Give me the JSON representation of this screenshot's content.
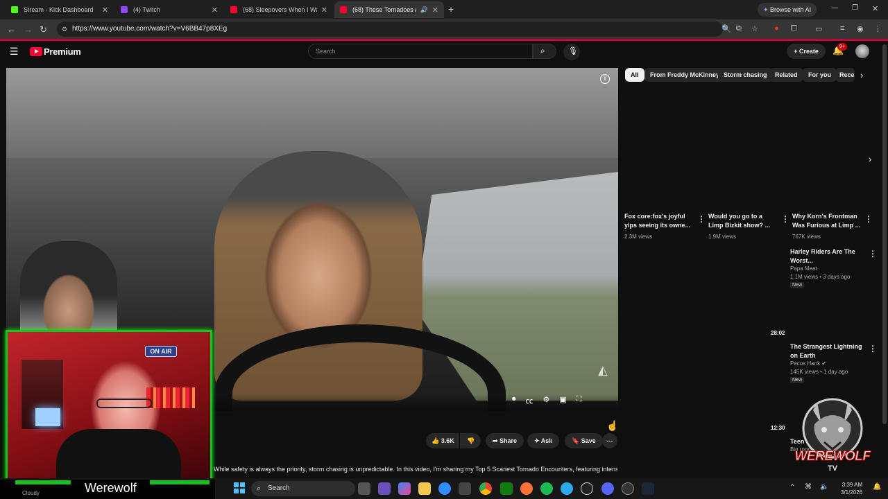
{
  "browser": {
    "tabs": [
      {
        "title": "Stream - Kick Dashboard",
        "favicon_color": "#53fc18",
        "active": false
      },
      {
        "title": "(4) Twitch",
        "favicon_color": "#9146ff",
        "active": false
      },
      {
        "title": "(68) Sleepovers When I Was A Kid",
        "favicon_color": "#ff0033",
        "active": false
      },
      {
        "title": "(68) These Tornadoes Almost",
        "favicon_color": "#ff0033",
        "active": true
      }
    ],
    "new_tab_label": "+",
    "browse_ai_label": "Browse with AI",
    "url": "https://www.youtube.com/watch?v=V6BB47p8XEg"
  },
  "youtube": {
    "logo_label": "Premium",
    "search_placeholder": "Search",
    "create_label": "Create",
    "notification_count": "9+",
    "actions": {
      "likes": "3.6K",
      "share": "Share",
      "ask": "Ask",
      "save": "Save"
    },
    "description": "While safety is always the priority, storm chasing is unpredictable. In this video, I'm sharing my Top 5 Scariest Tornado Encounters, featuring intense footage",
    "chips": [
      "All",
      "From Freddy McKinney",
      "Storm chasing",
      "Related",
      "For you",
      "Rece"
    ],
    "shorts": [
      {
        "title": "Fox core:fox's joyful yips seeing its owne...",
        "views": "2.3M views"
      },
      {
        "title": "Would you go to a Limp Bizkit show? ...",
        "views": "1.9M views"
      },
      {
        "title": "Why Korn's Frontman Was Furious at Limp ...",
        "views": "767K views"
      }
    ],
    "videos": [
      {
        "title": "Harley Riders Are The Worst...",
        "channel": "Papa Meat",
        "meta": "1.1M views • 3 days ago",
        "badge": "New",
        "duration": ""
      },
      {
        "title": "The Strangest Lightning on Earth",
        "channel": "Pecos Hank",
        "meta": "145K views • 1 day ago",
        "badge": "New",
        "duration": "28:02"
      },
      {
        "title": "Teen torture camps",
        "channel": "Big rogo",
        "meta": "",
        "badge": "",
        "duration": "12:30"
      }
    ]
  },
  "webcam": {
    "sign_text": "ON AIR",
    "streamer_label": "Werewolf",
    "sub_label": "Cloudy"
  },
  "overlay_logo": {
    "line1": "WEREWOLF",
    "line2": "TV"
  },
  "taskbar": {
    "search_label": "Search",
    "time": "3:39 AM",
    "date": "3/1/2026"
  },
  "colors": {
    "accent_red": "#ff0033",
    "green_frame": "#16c21f",
    "bg": "#0f0f0f"
  }
}
